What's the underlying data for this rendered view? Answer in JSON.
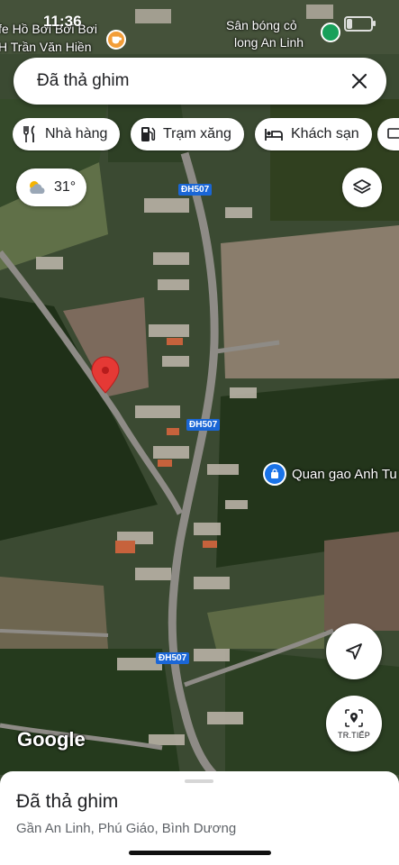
{
  "status_bar": {
    "time": "11:36"
  },
  "search": {
    "query": "Đã thả ghim"
  },
  "chips": [
    {
      "label": "Nhà hàng",
      "icon": "restaurant-icon"
    },
    {
      "label": "Trạm xăng",
      "icon": "gas-station-icon"
    },
    {
      "label": "Khách sạn",
      "icon": "hotel-icon"
    }
  ],
  "weather": {
    "temperature": "31°",
    "icon": "partly-cloudy-icon"
  },
  "map_labels": {
    "poi_cafe_line1": "fe Hồ Bơi Bơi Bơi",
    "poi_cafe_line2": "H Trần Văn Hiền",
    "poi_stadium_line1": "Sân bóng cỏ",
    "poi_stadium_line2": "long An Linh",
    "road_1": "ĐH507",
    "road_2": "ĐH507",
    "road_3": "ĐH507",
    "poi_shop": "Quan gao Anh Tu"
  },
  "controls": {
    "streetview_label": "TR.TIẾP"
  },
  "attribution": "Google",
  "bottom_sheet": {
    "title": "Đã thả ghim",
    "subtitle": "Gần An Linh, Phú Giáo, Bình Dương"
  },
  "colors": {
    "pin": "#e53935",
    "accent": "#1a73e8",
    "road_label": "#1a66d6"
  }
}
